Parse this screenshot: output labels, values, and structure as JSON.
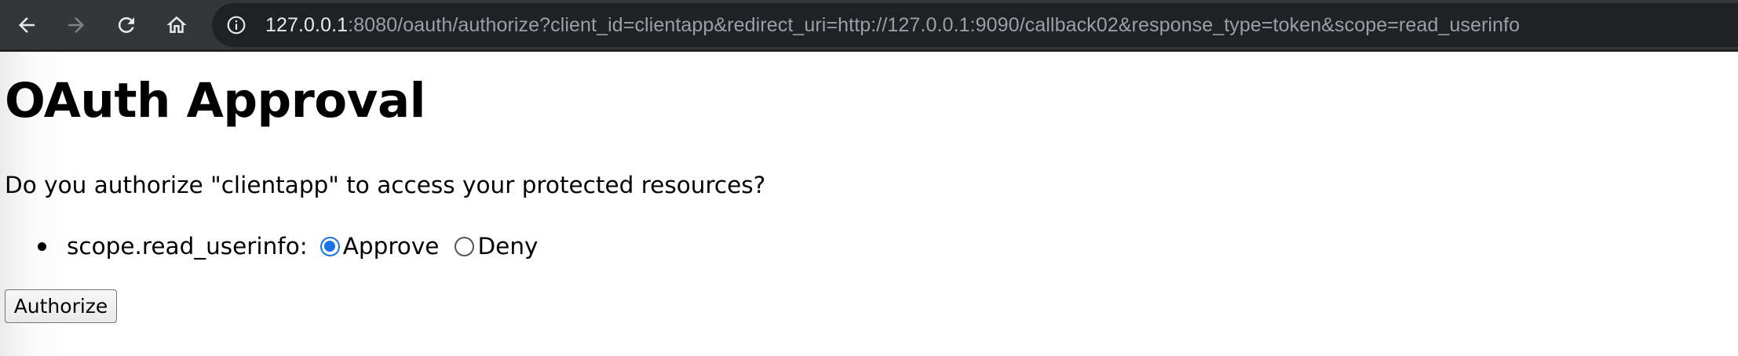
{
  "browser": {
    "url_host": "127.0.0.1",
    "url_rest": ":8080/oauth/authorize?client_id=clientapp&redirect_uri=http://127.0.0.1:9090/callback02&response_type=token&scope=read_userinfo",
    "icons": {
      "back": "arrow-left-icon",
      "forward": "arrow-right-icon",
      "reload": "reload-icon",
      "home": "home-icon",
      "site_info": "info-icon"
    },
    "colors": {
      "toolbar_bg": "#35363a",
      "omnibox_bg": "#202124",
      "url_host": "#e8eaed",
      "url_rest": "#9aa0a6"
    }
  },
  "page": {
    "title": "OAuth Approval",
    "question": "Do you authorize \"clientapp\" to access your protected resources?",
    "scopes": [
      {
        "name": "scope.read_userinfo:",
        "options": [
          {
            "label": "Approve",
            "selected": true
          },
          {
            "label": "Deny",
            "selected": false
          }
        ]
      }
    ],
    "submit_label": "Authorize",
    "colors": {
      "radio_accent": "#1a73e8"
    }
  }
}
